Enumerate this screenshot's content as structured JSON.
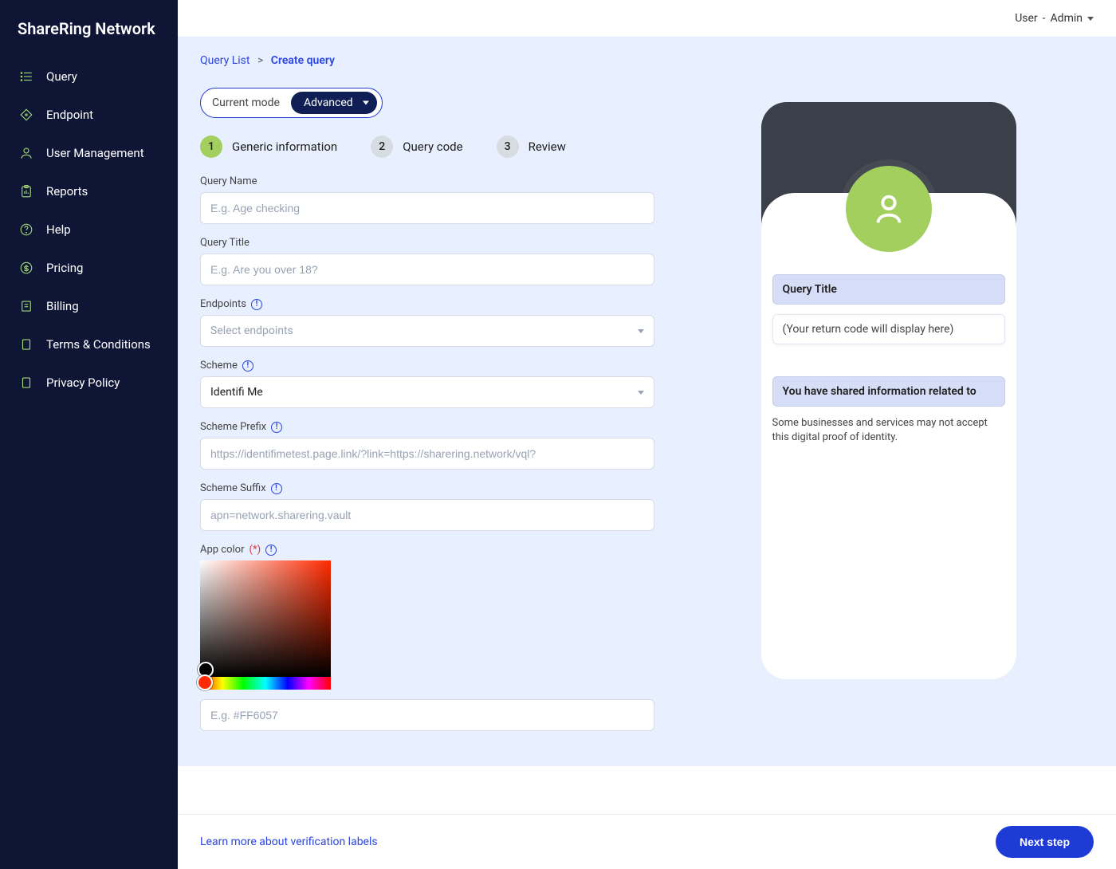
{
  "brand": "ShareRing Network",
  "user_menu": {
    "user_label": "User",
    "sep": "-",
    "role": "Admin"
  },
  "sidebar": {
    "items": [
      {
        "label": "Query"
      },
      {
        "label": "Endpoint"
      },
      {
        "label": "User Management"
      },
      {
        "label": "Reports"
      },
      {
        "label": "Help"
      },
      {
        "label": "Pricing"
      },
      {
        "label": "Billing"
      },
      {
        "label": "Terms & Conditions"
      },
      {
        "label": "Privacy Policy"
      }
    ]
  },
  "breadcrumb": {
    "parent": "Query List",
    "sep": ">",
    "current": "Create query"
  },
  "mode": {
    "label": "Current mode",
    "value": "Advanced"
  },
  "steps": [
    {
      "num": "1",
      "label": "Generic information"
    },
    {
      "num": "2",
      "label": "Query code"
    },
    {
      "num": "3",
      "label": "Review"
    }
  ],
  "form": {
    "query_name": {
      "label": "Query Name",
      "placeholder": "E.g. Age checking",
      "value": ""
    },
    "query_title": {
      "label": "Query Title",
      "placeholder": "E.g. Are you over 18?",
      "value": ""
    },
    "endpoints": {
      "label": "Endpoints",
      "placeholder": "Select endpoints",
      "value": ""
    },
    "scheme": {
      "label": "Scheme",
      "value": "Identifi Me"
    },
    "scheme_prefix": {
      "label": "Scheme Prefix",
      "placeholder": "https://identifimetest.page.link/?link=https://sharering.network/vql?",
      "value": ""
    },
    "scheme_suffix": {
      "label": "Scheme Suffix",
      "placeholder": "apn=network.sharering.vault",
      "value": ""
    },
    "app_color": {
      "label": "App color",
      "required_marker": "(*)",
      "hex_placeholder": "E.g. #FF6057",
      "value": ""
    }
  },
  "preview": {
    "title_band": "Query Title",
    "return_band": "(Your return code will display here)",
    "shared_band": "You have shared information related to",
    "disclaimer": "Some businesses and services may not accept this digital proof of identity."
  },
  "footer": {
    "learn_more": "Learn more about verification labels",
    "next": "Next step"
  }
}
